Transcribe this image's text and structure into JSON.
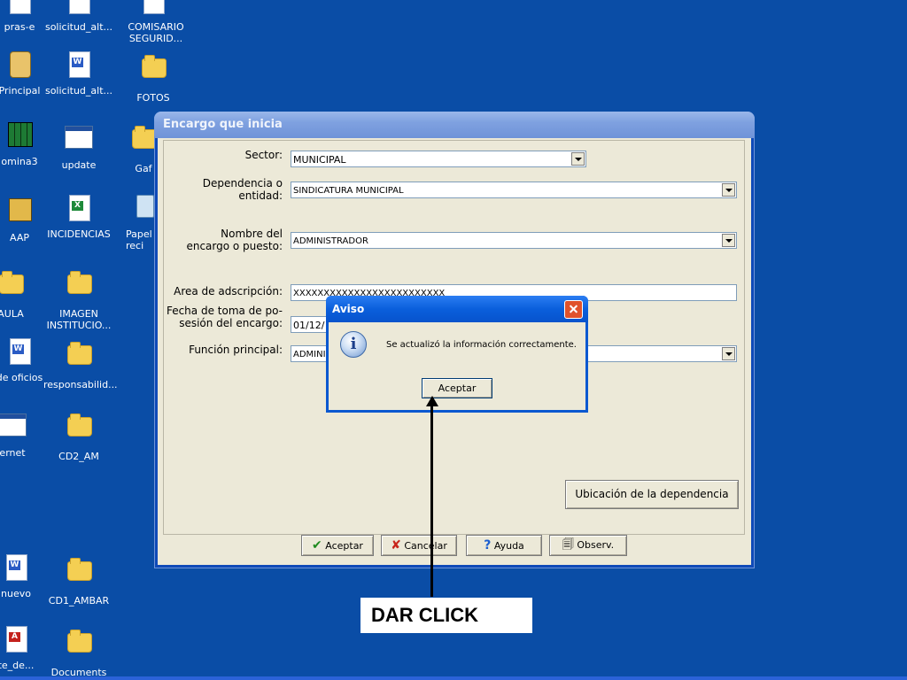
{
  "desktop": {
    "icons": [
      {
        "label": "pras-e",
        "type": "doc"
      },
      {
        "label": "solicitud_alt...",
        "type": "doc"
      },
      {
        "label": "COMISARIO SEGURID...",
        "type": "doc"
      },
      {
        "label": "Principal",
        "type": "app"
      },
      {
        "label": "solicitud_alt...",
        "type": "word"
      },
      {
        "label": "FOTOS",
        "type": "folder"
      },
      {
        "label": "omina3",
        "type": "app"
      },
      {
        "label": "update",
        "type": "window"
      },
      {
        "label": "Gaf",
        "type": "folder"
      },
      {
        "label": "AAP",
        "type": "app"
      },
      {
        "label": "INCIDENCIAS",
        "type": "excel"
      },
      {
        "label": "Papel reci",
        "type": "recycle"
      },
      {
        "label": "AULA",
        "type": "folder"
      },
      {
        "label": "IMAGEN INSTITUCIO...",
        "type": "folder"
      },
      {
        "label": "de oficios",
        "type": "word"
      },
      {
        "label": "responsabilid...",
        "type": "folder"
      },
      {
        "label": "ernet",
        "type": "app"
      },
      {
        "label": "CD2_AM",
        "type": "folder"
      },
      {
        "label": "nuevo",
        "type": "word"
      },
      {
        "label": "CD1_AMBAR",
        "type": "folder"
      },
      {
        "label": "te_de...",
        "type": "pdf"
      },
      {
        "label": "Documents",
        "type": "folder"
      }
    ]
  },
  "main_window": {
    "title": "Encargo que inicia",
    "fields": {
      "sector_label": "Sector:",
      "sector_value": "MUNICIPAL",
      "dependencia_label_1": "Dependencia o",
      "dependencia_label_2": "entidad:",
      "dependencia_value": "SINDICATURA MUNICIPAL",
      "nombre_label_1": "Nombre del",
      "nombre_label_2": "encargo o puesto:",
      "nombre_value": "ADMINISTRADOR",
      "area_label": "Area de adscripción:",
      "area_value": "XXXXXXXXXXXXXXXXXXXXXXXXX",
      "fecha_label_1": "Fecha de toma de po-",
      "fecha_label_2": "sesión del encargo:",
      "fecha_value": "01/12/",
      "funcion_label": "Función principal:",
      "funcion_value": "ADMINI"
    },
    "ubicacion_button": "Ubicación de la dependencia",
    "buttons": {
      "aceptar": "Aceptar",
      "cancelar": "Cancelar",
      "ayuda": "Ayuda",
      "observ": "Observ."
    }
  },
  "dialog": {
    "title": "Aviso",
    "message": "Se actualizó la información correctamente.",
    "ok_label": "Aceptar"
  },
  "annotation": {
    "text": "DAR CLICK"
  }
}
